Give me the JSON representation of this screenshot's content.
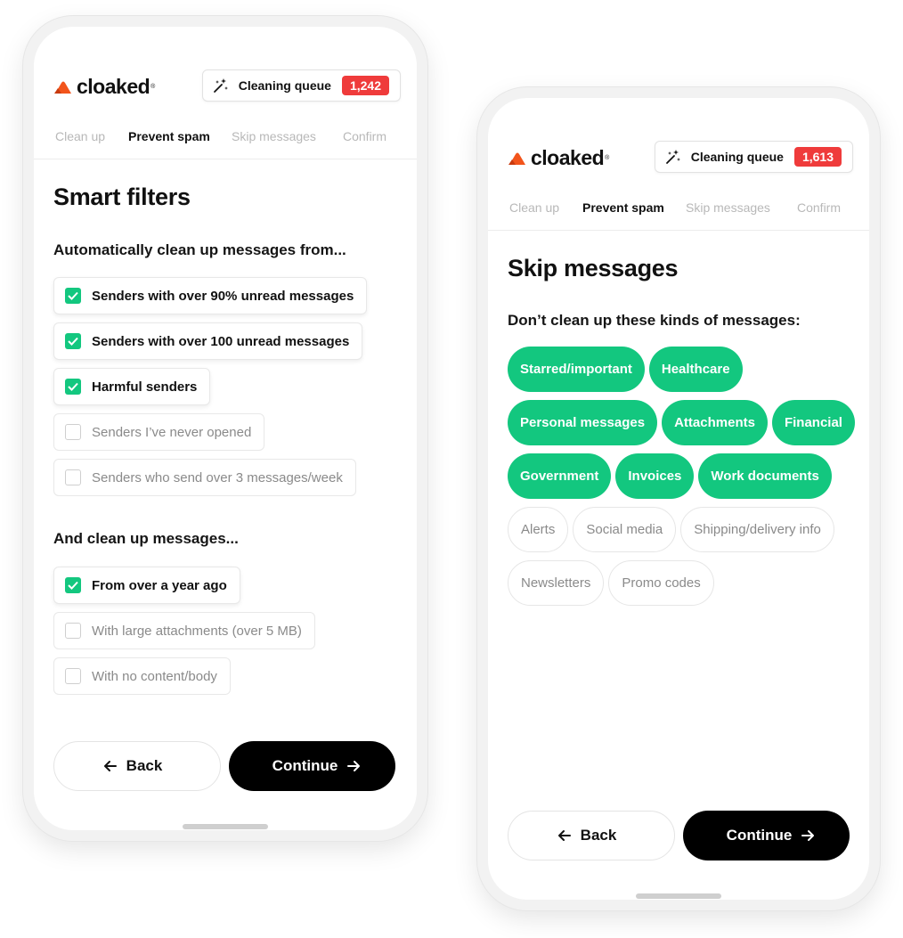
{
  "colors": {
    "accent": "#13c77f",
    "badge": "#ef3b3b",
    "brand_orange": "#f2541b",
    "primary_button": "#000000"
  },
  "phone1": {
    "brand": "cloaked",
    "trademark": "®",
    "queue": {
      "label": "Cleaning queue",
      "count": "1,242"
    },
    "tabs": [
      "Clean up",
      "Prevent spam",
      "Skip messages",
      "Confirm"
    ],
    "active_tab": "Prevent spam",
    "title": "Smart filters",
    "section1": "Automatically clean up messages from...",
    "filters1": [
      {
        "label": "Senders with over 90% unread messages",
        "checked": true
      },
      {
        "label": "Senders with over 100 unread messages",
        "checked": true
      },
      {
        "label": "Harmful senders",
        "checked": true
      },
      {
        "label": "Senders I’ve never opened",
        "checked": false
      },
      {
        "label": "Senders who send over 3 messages/week",
        "checked": false
      }
    ],
    "section2": "And clean up messages...",
    "filters2": [
      {
        "label": "From over a year ago",
        "checked": true
      },
      {
        "label": "With large attachments (over 5 MB)",
        "checked": false
      },
      {
        "label": "With no content/body",
        "checked": false
      }
    ],
    "back_label": "Back",
    "continue_label": "Continue"
  },
  "phone2": {
    "brand": "cloaked",
    "trademark": "®",
    "queue": {
      "label": "Cleaning queue",
      "count": "1,613"
    },
    "tabs": [
      "Clean up",
      "Prevent spam",
      "Skip messages",
      "Confirm"
    ],
    "active_tab": "Prevent spam",
    "title": "Skip messages",
    "section": "Don’t clean up these kinds of messages:",
    "chips": [
      {
        "label": "Starred/important",
        "selected": true
      },
      {
        "label": "Healthcare",
        "selected": true
      },
      {
        "label": "Personal messages",
        "selected": true
      },
      {
        "label": "Attachments",
        "selected": true
      },
      {
        "label": "Financial",
        "selected": true
      },
      {
        "label": "Government",
        "selected": true
      },
      {
        "label": "Invoices",
        "selected": true
      },
      {
        "label": "Work documents",
        "selected": true
      },
      {
        "label": "Alerts",
        "selected": false
      },
      {
        "label": "Social media",
        "selected": false
      },
      {
        "label": "Shipping/delivery info",
        "selected": false
      },
      {
        "label": "Newsletters",
        "selected": false
      },
      {
        "label": "Promo codes",
        "selected": false
      }
    ],
    "back_label": "Back",
    "continue_label": "Continue"
  }
}
